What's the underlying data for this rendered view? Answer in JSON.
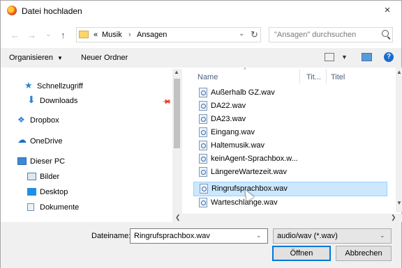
{
  "dialog": {
    "title": "Datei hochladen",
    "close_glyph": "×"
  },
  "address_bar": {
    "prefix": "«",
    "crumbs": [
      "Musik",
      "Ansagen"
    ],
    "separator": "›",
    "search_placeholder": "\"Ansagen\" durchsuchen"
  },
  "nav_buttons": {
    "back": "←",
    "forward": "→",
    "recent": "⌄",
    "up": "↑"
  },
  "toolbar": {
    "organize_label": "Organisieren",
    "organize_arrow": "▼",
    "new_folder_label": "Neuer Ordner",
    "help_glyph": "?"
  },
  "sidebar": {
    "items": [
      {
        "label": "Schnellzugriff",
        "icon": "star-icon",
        "color": "#2e83d8"
      },
      {
        "label": "Downloads",
        "icon": "download-icon",
        "color": "#2e83d8"
      },
      {
        "label": "Dropbox",
        "icon": "dropbox-icon",
        "color": "#2e7ee6"
      },
      {
        "label": "OneDrive",
        "icon": "cloud-icon",
        "color": "#1d6fc7"
      },
      {
        "label": "Dieser PC",
        "icon": "computer-icon",
        "color": "#3c8ad6"
      },
      {
        "label": "Bilder",
        "icon": "pictures-icon",
        "color": "#5a7fa6"
      },
      {
        "label": "Desktop",
        "icon": "desktop-icon",
        "color": "#1e90e6"
      },
      {
        "label": "Dokumente",
        "icon": "documents-icon",
        "color": "#6c8fb3"
      }
    ]
  },
  "file_list": {
    "columns": [
      "Name",
      "Tit...",
      "Titel"
    ],
    "files": [
      "Außerhalb GZ.wav",
      "DA22.wav",
      "DA23.wav",
      "Eingang.wav",
      "Haltemusik.wav",
      "keinAgent-Sprachbox.w...",
      "LängereWartezeit.wav",
      "Ringrufsprachbox.wav",
      "Warteschlange.wav"
    ],
    "selected_index": 7
  },
  "footer": {
    "filename_label": "Dateiname:",
    "filename_value": "Ringrufsprachbox.wav",
    "filetype_value": "audio/wav (*.wav)",
    "open_label": "Öffnen",
    "cancel_label": "Abbrechen"
  },
  "colors": {
    "selection": "#cce8ff",
    "accent": "#0078d7"
  }
}
